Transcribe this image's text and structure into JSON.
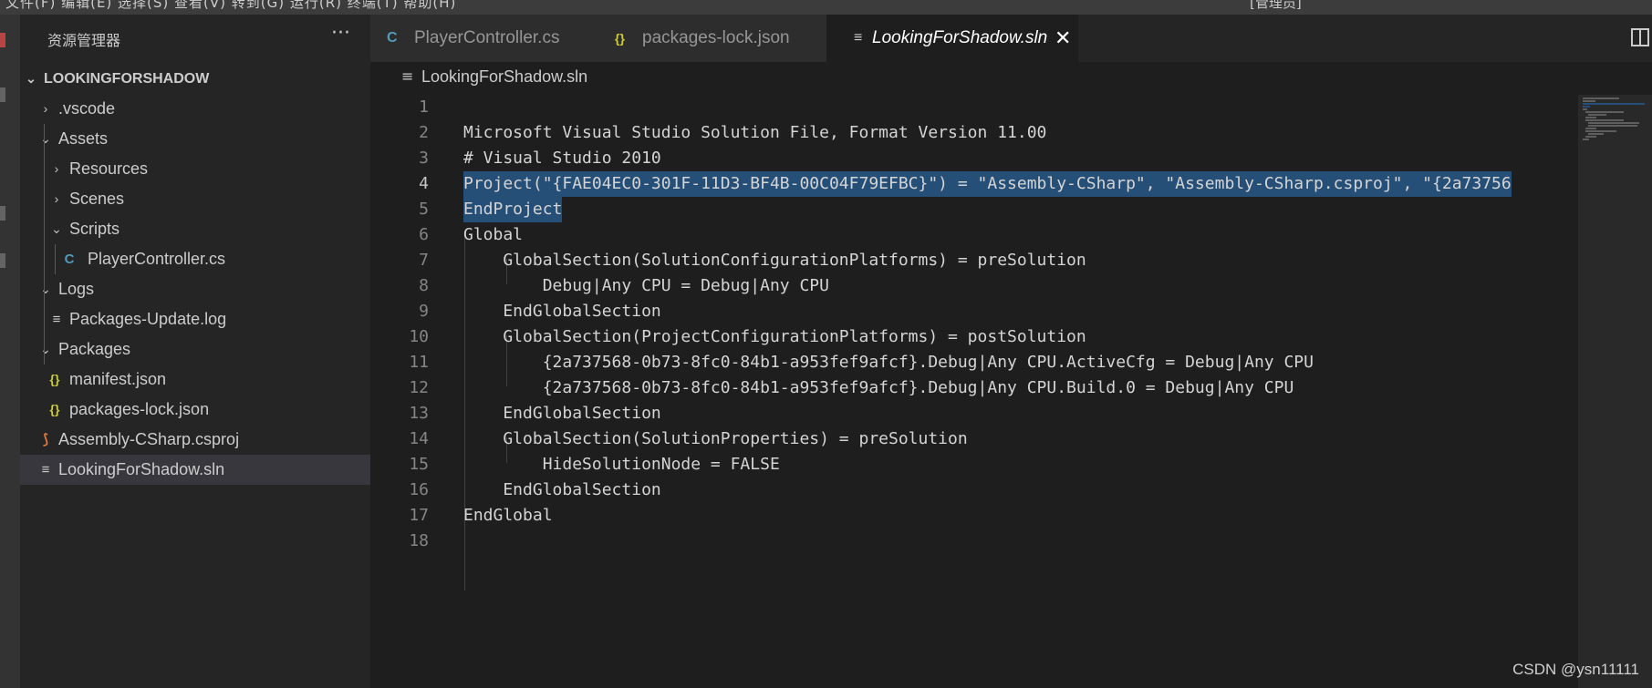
{
  "title_bar": {
    "menu_text": "文件(F)   编辑(E)   选择(S)   查看(V)   转到(G)   运行(R)   终端(T)   帮助(H)",
    "command_text": "[管理员]"
  },
  "explorer": {
    "title": "资源管理器",
    "more_label": "···",
    "root": "LOOKINGFORSHADOW",
    "items": [
      {
        "label": ".vscode",
        "kind": "folder",
        "expanded": false
      },
      {
        "label": "Assets",
        "kind": "folder",
        "expanded": true
      },
      {
        "label": "Resources",
        "kind": "folder",
        "expanded": false
      },
      {
        "label": "Scenes",
        "kind": "folder",
        "expanded": false
      },
      {
        "label": "Scripts",
        "kind": "folder",
        "expanded": true
      },
      {
        "label": "PlayerController.cs",
        "kind": "csharp-file"
      },
      {
        "label": "Logs",
        "kind": "folder",
        "expanded": true
      },
      {
        "label": "Packages-Update.log",
        "kind": "text-file"
      },
      {
        "label": "Packages",
        "kind": "folder",
        "expanded": true
      },
      {
        "label": "manifest.json",
        "kind": "json-file"
      },
      {
        "label": "packages-lock.json",
        "kind": "json-file"
      },
      {
        "label": "Assembly-CSharp.csproj",
        "kind": "rss-file"
      },
      {
        "label": "LookingForShadow.sln",
        "kind": "text-file",
        "selected": true
      }
    ]
  },
  "tabs": [
    {
      "label": "PlayerController.cs",
      "icon": "C#",
      "active": false
    },
    {
      "label": "packages-lock.json",
      "icon": "{}",
      "active": false
    },
    {
      "label": "LookingForShadow.sln",
      "icon": "≡",
      "active": true,
      "close": "✕"
    }
  ],
  "breadcrumb": {
    "file": "LookingForShadow.sln"
  },
  "editor": {
    "lines": [
      {
        "n": "1",
        "text": ""
      },
      {
        "n": "2",
        "text": "Microsoft Visual Studio Solution File, Format Version 11.00"
      },
      {
        "n": "3",
        "text": "# Visual Studio 2010"
      },
      {
        "n": "4",
        "text": "Project(\"{FAE04EC0-301F-11D3-BF4B-00C04F79EFBC}\") = \"Assembly-CSharp\", \"Assembly-CSharp.csproj\", \"{2a73756"
      },
      {
        "n": "5",
        "text": "EndProject"
      },
      {
        "n": "6",
        "text": "Global"
      },
      {
        "n": "7",
        "text": "    GlobalSection(SolutionConfigurationPlatforms) = preSolution"
      },
      {
        "n": "8",
        "text": "        Debug|Any CPU = Debug|Any CPU"
      },
      {
        "n": "9",
        "text": "    EndGlobalSection"
      },
      {
        "n": "10",
        "text": "    GlobalSection(ProjectConfigurationPlatforms) = postSolution"
      },
      {
        "n": "11",
        "text": "        {2a737568-0b73-8fc0-84b1-a953fef9afcf}.Debug|Any CPU.ActiveCfg = Debug|Any CPU"
      },
      {
        "n": "12",
        "text": "        {2a737568-0b73-8fc0-84b1-a953fef9afcf}.Debug|Any CPU.Build.0 = Debug|Any CPU"
      },
      {
        "n": "13",
        "text": "    EndGlobalSection"
      },
      {
        "n": "14",
        "text": "    GlobalSection(SolutionProperties) = preSolution"
      },
      {
        "n": "15",
        "text": "        HideSolutionNode = FALSE"
      },
      {
        "n": "16",
        "text": "    EndGlobalSection"
      },
      {
        "n": "17",
        "text": "EndGlobal"
      },
      {
        "n": "18",
        "text": ""
      }
    ],
    "current_line": "4",
    "selected_lines": [
      "4",
      "5"
    ]
  },
  "watermark": "CSDN @ysn11111",
  "colors": {
    "background": "#1e1e1e",
    "sidebar": "#252526",
    "selection": "#264f78",
    "csharp_icon": "#519aba",
    "json_icon": "#cbcb41",
    "rss_icon": "#e37933"
  }
}
